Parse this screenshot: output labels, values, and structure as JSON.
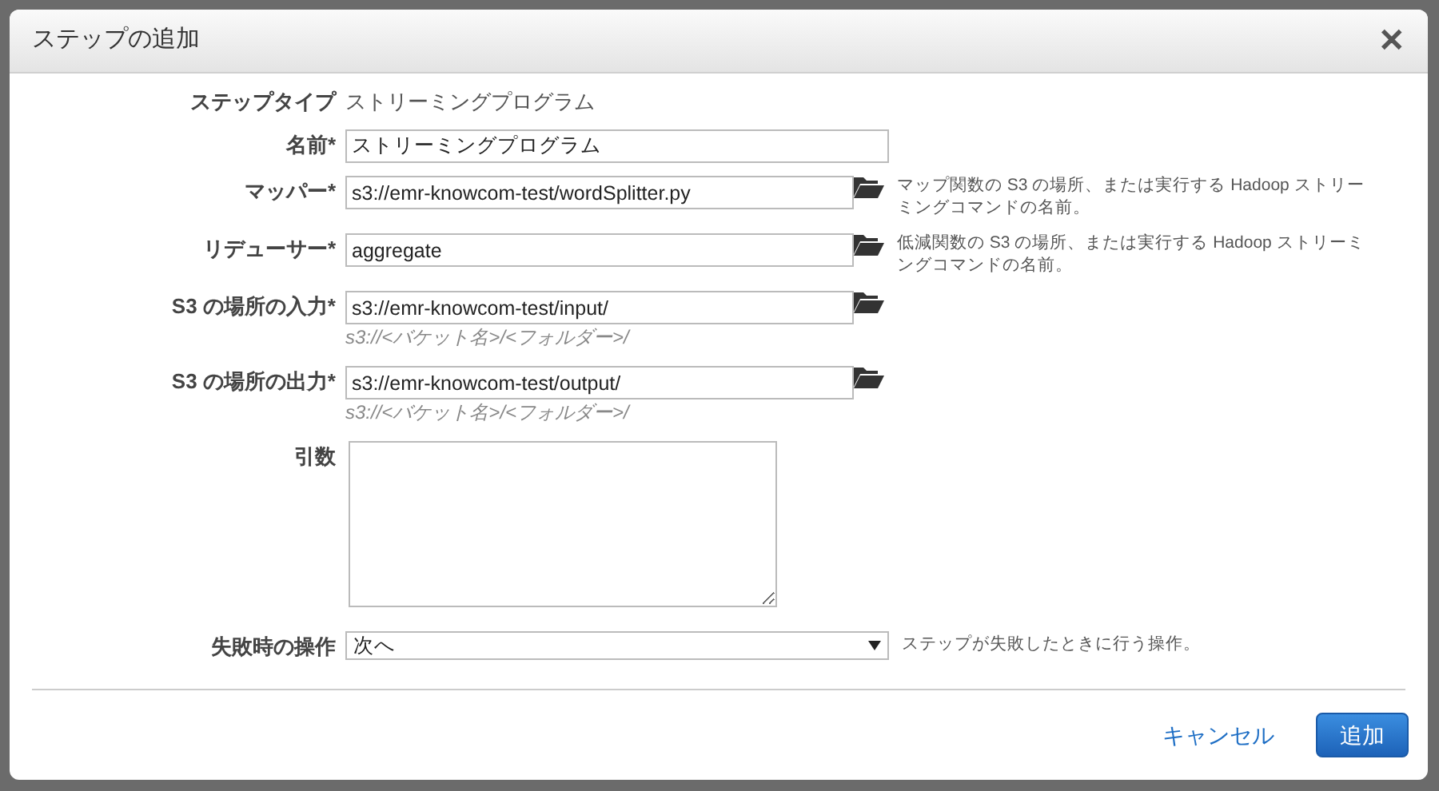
{
  "dialog": {
    "title": "ステップの追加",
    "close": "✕"
  },
  "fields": [
    {
      "kind": "static",
      "label": "ステップタイプ",
      "value": "ストリーミングプログラム"
    },
    {
      "kind": "text",
      "label": "名前*",
      "value": "ストリーミングプログラム"
    },
    {
      "kind": "file",
      "label": "マッパー*",
      "value": "s3://emr-knowcom-test/wordSplitter.py",
      "help": "マップ関数の S3 の場所、または実行する Hadoop ストリーミングコマンドの名前。"
    },
    {
      "kind": "file",
      "label": "リデューサー*",
      "value": "aggregate",
      "help": "低減関数の S3 の場所、または実行する Hadoop ストリーミングコマンドの名前。"
    },
    {
      "kind": "file",
      "label": "S3 の場所の入力*",
      "value": "s3://emr-knowcom-test/input/",
      "hint": "s3://<バケット名>/<フォルダー>/"
    },
    {
      "kind": "file",
      "label": "S3 の場所の出力*",
      "value": "s3://emr-knowcom-test/output/",
      "hint": "s3://<バケット名>/<フォルダー>/"
    },
    {
      "kind": "textarea",
      "label": "引数"
    },
    {
      "kind": "select",
      "label": "失敗時の操作",
      "value": "次へ",
      "help": "ステップが失敗したときに行う操作。"
    }
  ],
  "buttons": [
    {
      "kind": "link",
      "label": "キャンセル"
    },
    {
      "kind": "primary",
      "label": "追加"
    }
  ]
}
